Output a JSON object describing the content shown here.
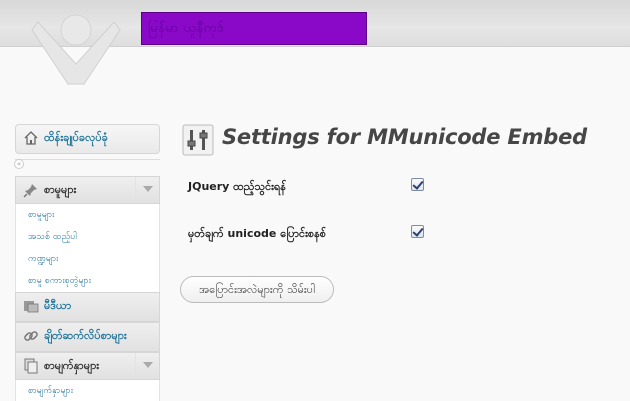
{
  "header": {
    "site_title": "မြန်မာ ယူနီကုဒ်"
  },
  "sidebar": {
    "dashboard_label": "ထိန်းချုပ်ခလုပ်ခုံ",
    "posts": {
      "label": "စာမူများ",
      "items": [
        {
          "label": "စာမူများ"
        },
        {
          "label": "အသစ် ထည့်ပါ"
        },
        {
          "label": "ကဏ္ဍများ"
        },
        {
          "label": "စာမူ စကားစုတွဲများ"
        }
      ]
    },
    "media_label": "မီဒီယာ",
    "links_label": "ချိတ်ဆက်လိပ်စာများ",
    "pages": {
      "label": "စာမျက်နှာများ",
      "items": [
        {
          "label": "စာမျက်နှာများ"
        }
      ]
    },
    "collapse_symbol": "«"
  },
  "main": {
    "title": "Settings for MMunicode Embed",
    "options": [
      {
        "label": "JQuery ထည့်သွင်းရန်",
        "checked": true
      },
      {
        "label": "မှတ်ချက် unicode ပြောင်းစနစ်",
        "checked": true
      }
    ],
    "save_button": "အပြောင်းအလဲများကို သိမ်းပါ"
  },
  "colors": {
    "header_banner": "#8a09c8",
    "link": "#21759b"
  }
}
